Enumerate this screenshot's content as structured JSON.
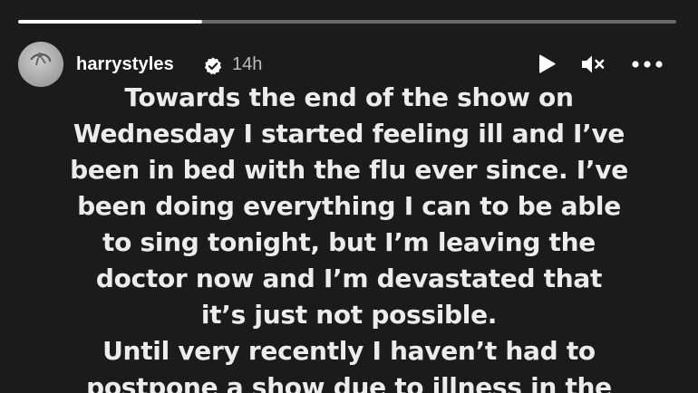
{
  "story": {
    "progress": 0.28,
    "account": {
      "username": "harrystyles",
      "verified": true,
      "time_ago": "14h"
    },
    "controls": {
      "play_icon": "play-icon",
      "mute_icon": "speaker-muted-icon",
      "more_icon": "more-horizontal-icon"
    },
    "caption_lines": [
      "Towards the end of the show on",
      "Wednesday I started feeling ill and I’ve",
      "been in bed with the flu ever since.  I’ve",
      "been doing everything I can to be able",
      "to sing tonight, but I’m leaving the",
      "doctor now and I’m devastated that",
      "it’s just not possible.",
      "Until very recently I haven’t had to",
      "postpone a show due to illness in the"
    ]
  }
}
